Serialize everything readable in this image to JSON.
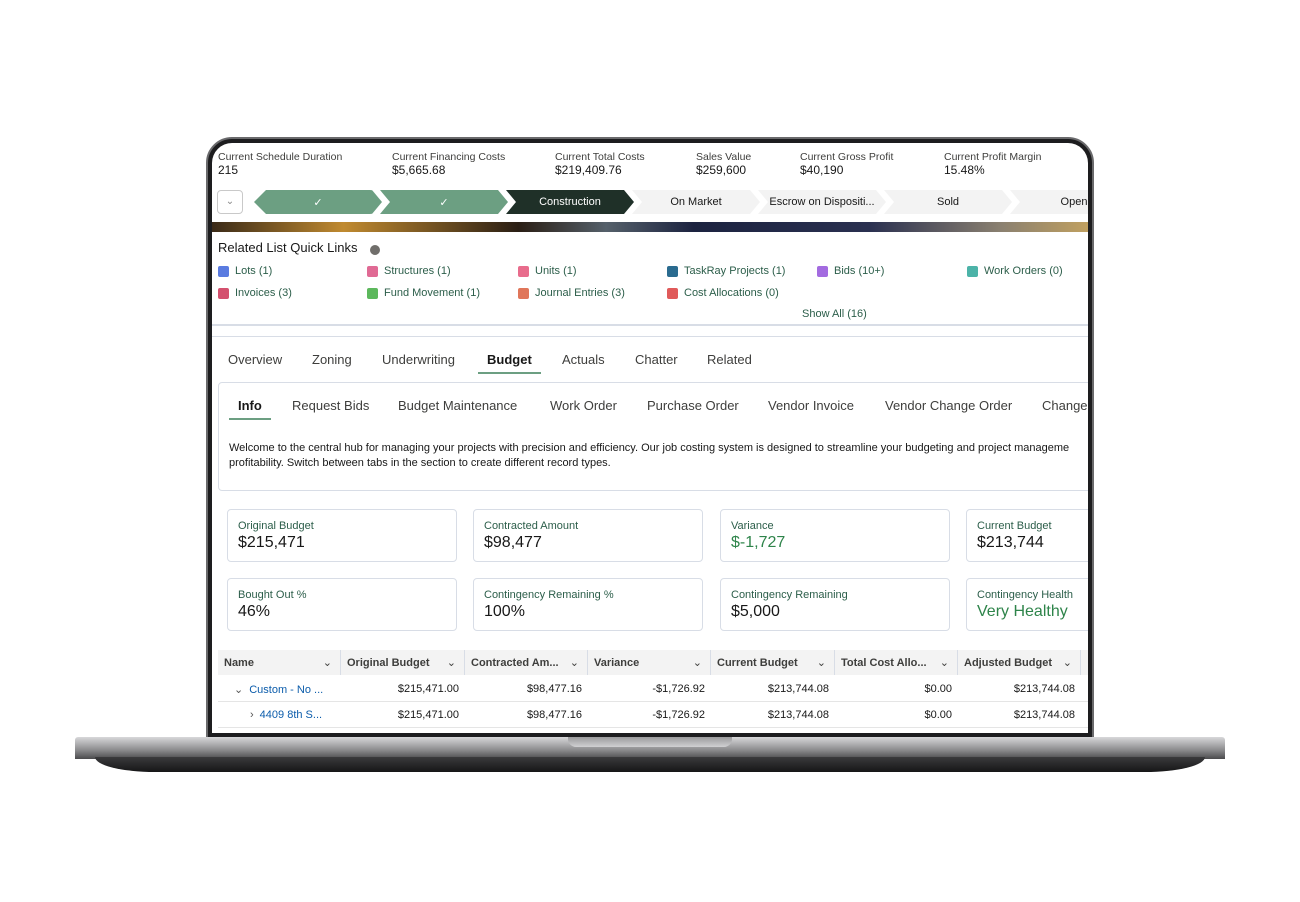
{
  "header_stats": [
    {
      "label": "Current Schedule Duration",
      "value": "215"
    },
    {
      "label": "Current Financing Costs",
      "value": "$5,665.68"
    },
    {
      "label": "Current Total Costs",
      "value": "$219,409.76"
    },
    {
      "label": "Sales Value",
      "value": "$259,600"
    },
    {
      "label": "Current Gross Profit",
      "value": "$40,190"
    },
    {
      "label": "Current Profit Margin",
      "value": "15.48%"
    }
  ],
  "path": {
    "steps": [
      {
        "label": "✓",
        "state": "complete"
      },
      {
        "label": "✓",
        "state": "complete"
      },
      {
        "label": "Construction",
        "state": "current"
      },
      {
        "label": "On Market",
        "state": "upcoming"
      },
      {
        "label": "Escrow on Dispositi...",
        "state": "upcoming"
      },
      {
        "label": "Sold",
        "state": "upcoming"
      },
      {
        "label": "Open",
        "state": "upcoming"
      }
    ]
  },
  "quick_links": {
    "title": "Related List Quick Links",
    "show_all": "Show All (16)",
    "items": [
      {
        "label": "Lots (1)",
        "color": "#5a7be0"
      },
      {
        "label": "Structures (1)",
        "color": "#e06a94"
      },
      {
        "label": "Units (1)",
        "color": "#e86c8c"
      },
      {
        "label": "TaskRay Projects (1)",
        "color": "#2a6b8f"
      },
      {
        "label": "Bids (10+)",
        "color": "#a36be0"
      },
      {
        "label": "Work Orders (0)",
        "color": "#4cb3a8"
      },
      {
        "label": "Invoices (3)",
        "color": "#d4506e"
      },
      {
        "label": "Fund Movement (1)",
        "color": "#5cb85c"
      },
      {
        "label": "Journal Entries (3)",
        "color": "#e0765a"
      },
      {
        "label": "Cost Allocations (0)",
        "color": "#e05a5a"
      }
    ]
  },
  "tabs": [
    {
      "label": "Overview"
    },
    {
      "label": "Zoning"
    },
    {
      "label": "Underwriting"
    },
    {
      "label": "Budget",
      "active": true
    },
    {
      "label": "Actuals"
    },
    {
      "label": "Chatter"
    },
    {
      "label": "Related"
    }
  ],
  "subtabs": [
    {
      "label": "Info",
      "active": true
    },
    {
      "label": "Request Bids"
    },
    {
      "label": "Budget Maintenance"
    },
    {
      "label": "Work Order"
    },
    {
      "label": "Purchase Order"
    },
    {
      "label": "Vendor Invoice"
    },
    {
      "label": "Vendor Change Order"
    },
    {
      "label": "Change"
    }
  ],
  "info_text": "Welcome to the central hub for managing your projects with precision and efficiency. Our job costing system is designed to streamline your budgeting and project manageme profitability. Switch between tabs in the section to create different record types.",
  "metrics": [
    {
      "label": "Original Budget",
      "value": "$215,471"
    },
    {
      "label": "Contracted Amount",
      "value": "$98,477"
    },
    {
      "label": "Variance",
      "value": "$-1,727",
      "color": "#2e844a"
    },
    {
      "label": "Current Budget",
      "value": "$213,744"
    },
    {
      "label": "Bought Out %",
      "value": "46%"
    },
    {
      "label": "Contingency Remaining %",
      "value": "100%"
    },
    {
      "label": "Contingency Remaining",
      "value": "$5,000"
    },
    {
      "label": "Contingency Health",
      "value": "Very Healthy",
      "color": "#2e844a"
    }
  ],
  "table": {
    "columns": [
      "Name",
      "Original Budget",
      "Contracted Am...",
      "Variance",
      "Current Budget",
      "Total Cost Allo...",
      "Adjusted Budget"
    ],
    "rows": [
      {
        "name": "Custom - No ...",
        "expanded": true,
        "cells": [
          "$215,471.00",
          "$98,477.16",
          "-$1,726.92",
          "$213,744.08",
          "$0.00",
          "$213,744.08"
        ]
      },
      {
        "name": "4409 8th S...",
        "expanded": false,
        "cells": [
          "$215,471.00",
          "$98,477.16",
          "-$1,726.92",
          "$213,744.08",
          "$0.00",
          "$213,744.08"
        ]
      }
    ]
  }
}
